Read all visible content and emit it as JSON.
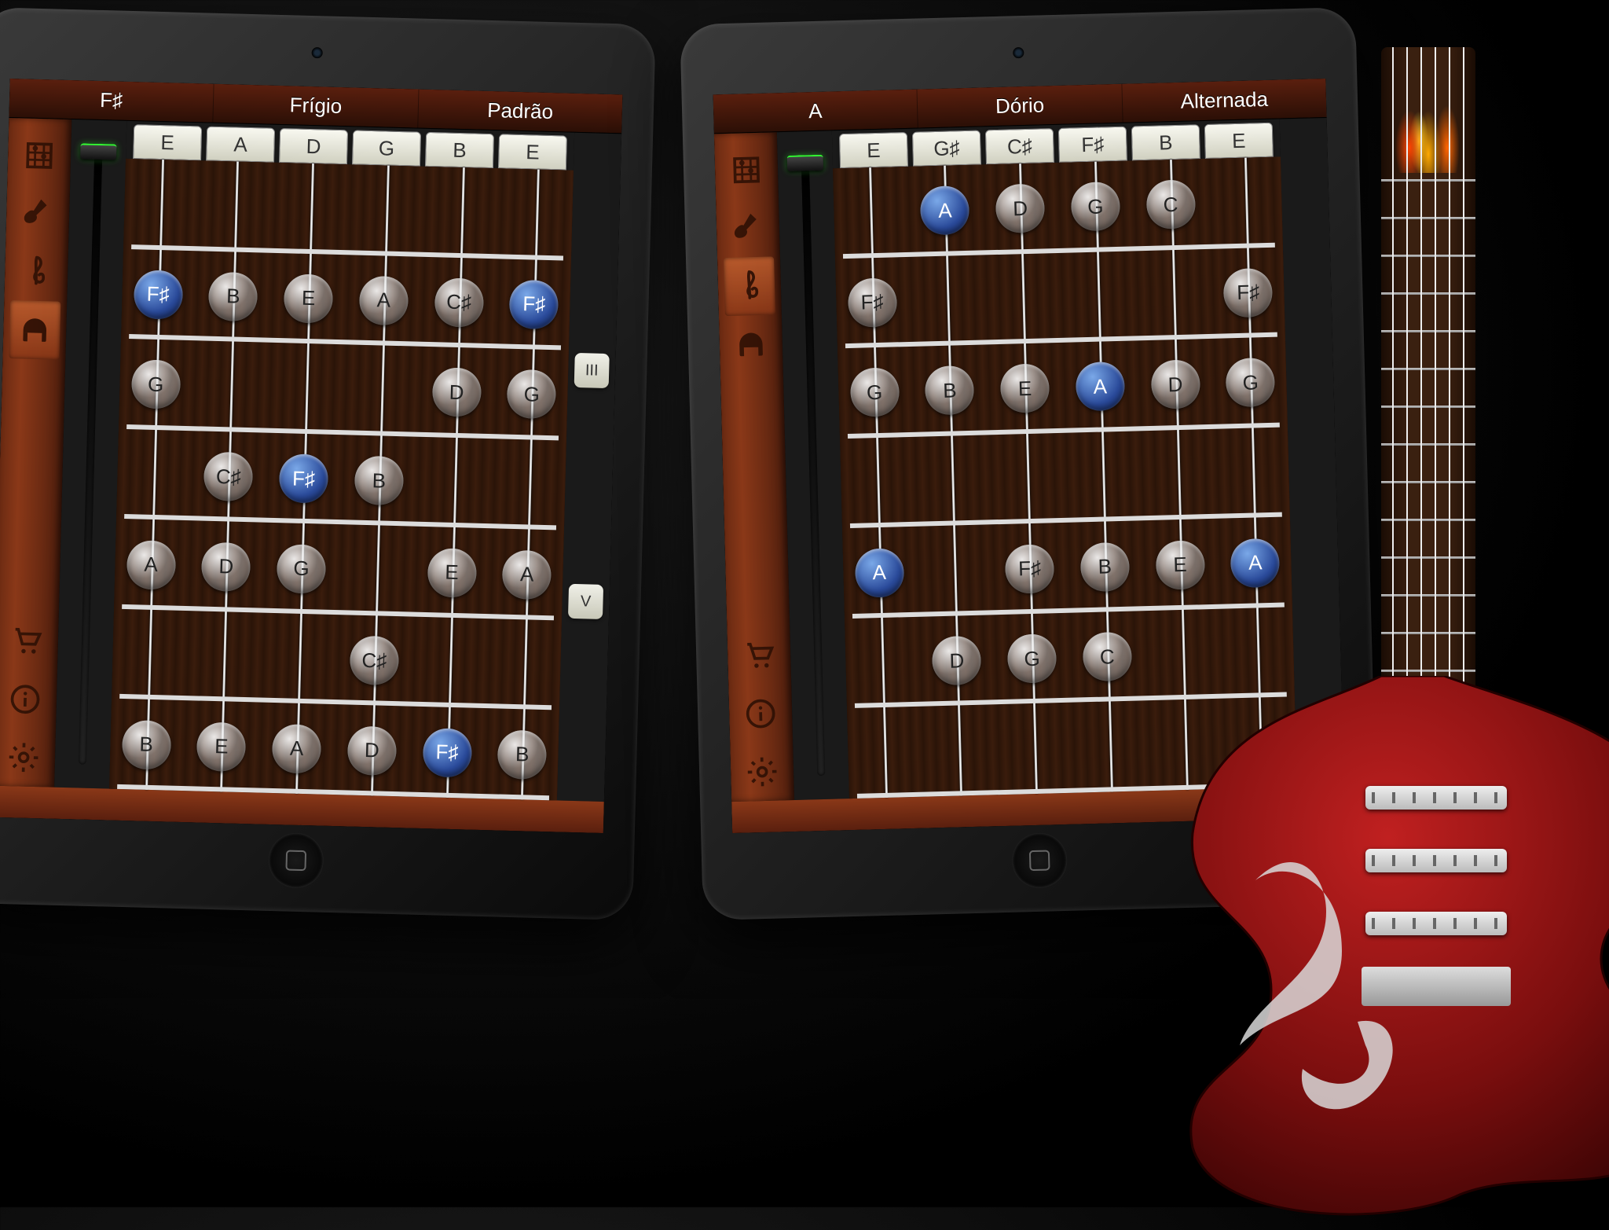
{
  "left": {
    "topbar": {
      "key": "F♯",
      "scale": "Frígio",
      "tuning": "Padrão"
    },
    "string_headers": [
      "E",
      "A",
      "D",
      "G",
      "B",
      "E"
    ],
    "position_markers": [
      "III",
      "V"
    ],
    "fretboard": {
      "rows": 7,
      "notes": [
        {
          "row": 2,
          "string": 1,
          "label": "F♯",
          "root": true
        },
        {
          "row": 2,
          "string": 2,
          "label": "B"
        },
        {
          "row": 2,
          "string": 3,
          "label": "E"
        },
        {
          "row": 2,
          "string": 4,
          "label": "A"
        },
        {
          "row": 2,
          "string": 5,
          "label": "C♯"
        },
        {
          "row": 2,
          "string": 6,
          "label": "F♯",
          "root": true
        },
        {
          "row": 3,
          "string": 1,
          "label": "G"
        },
        {
          "row": 3,
          "string": 5,
          "label": "D"
        },
        {
          "row": 3,
          "string": 6,
          "label": "G"
        },
        {
          "row": 4,
          "string": 2,
          "label": "C♯"
        },
        {
          "row": 4,
          "string": 3,
          "label": "F♯",
          "root": true
        },
        {
          "row": 4,
          "string": 4,
          "label": "B"
        },
        {
          "row": 5,
          "string": 1,
          "label": "A"
        },
        {
          "row": 5,
          "string": 2,
          "label": "D"
        },
        {
          "row": 5,
          "string": 3,
          "label": "G"
        },
        {
          "row": 5,
          "string": 5,
          "label": "E"
        },
        {
          "row": 5,
          "string": 6,
          "label": "A"
        },
        {
          "row": 6,
          "string": 4,
          "label": "C♯"
        },
        {
          "row": 7,
          "string": 1,
          "label": "B"
        },
        {
          "row": 7,
          "string": 2,
          "label": "E"
        },
        {
          "row": 7,
          "string": 3,
          "label": "A"
        },
        {
          "row": 7,
          "string": 4,
          "label": "D"
        },
        {
          "row": 7,
          "string": 5,
          "label": "F♯",
          "root": true
        },
        {
          "row": 7,
          "string": 6,
          "label": "B"
        }
      ]
    }
  },
  "right": {
    "topbar": {
      "key": "A",
      "scale": "Dório",
      "tuning": "Alternada"
    },
    "string_headers": [
      "E",
      "G♯",
      "C♯",
      "F♯",
      "B",
      "E"
    ],
    "fretboard": {
      "rows": 7,
      "notes": [
        {
          "row": 1,
          "string": 2,
          "label": "A",
          "root": true
        },
        {
          "row": 1,
          "string": 3,
          "label": "D"
        },
        {
          "row": 1,
          "string": 4,
          "label": "G"
        },
        {
          "row": 1,
          "string": 5,
          "label": "C"
        },
        {
          "row": 2,
          "string": 1,
          "label": "F♯"
        },
        {
          "row": 2,
          "string": 6,
          "label": "F♯"
        },
        {
          "row": 3,
          "string": 1,
          "label": "G"
        },
        {
          "row": 3,
          "string": 2,
          "label": "B"
        },
        {
          "row": 3,
          "string": 3,
          "label": "E"
        },
        {
          "row": 3,
          "string": 4,
          "label": "A",
          "root": true
        },
        {
          "row": 3,
          "string": 5,
          "label": "D"
        },
        {
          "row": 3,
          "string": 6,
          "label": "G"
        },
        {
          "row": 5,
          "string": 1,
          "label": "A",
          "root": true
        },
        {
          "row": 5,
          "string": 3,
          "label": "F♯"
        },
        {
          "row": 5,
          "string": 4,
          "label": "B"
        },
        {
          "row": 5,
          "string": 5,
          "label": "E"
        },
        {
          "row": 5,
          "string": 6,
          "label": "A",
          "root": true
        },
        {
          "row": 6,
          "string": 2,
          "label": "D"
        },
        {
          "row": 6,
          "string": 3,
          "label": "G"
        },
        {
          "row": 6,
          "string": 4,
          "label": "C"
        }
      ]
    }
  },
  "sidebar_icons": [
    "chord-diagram",
    "guitar",
    "treble-clef",
    "headphones",
    "cart",
    "info",
    "settings"
  ],
  "selected_left": "headphones",
  "selected_right": "treble-clef"
}
